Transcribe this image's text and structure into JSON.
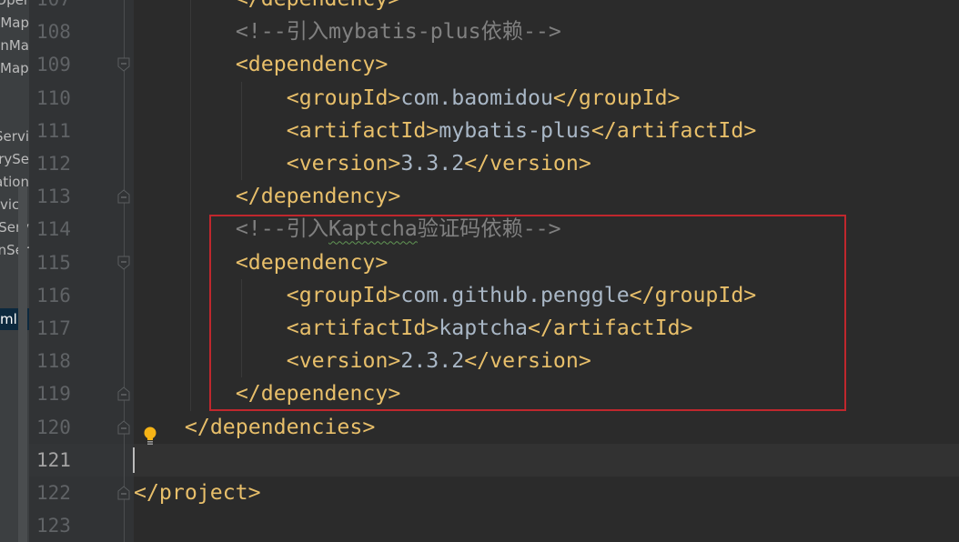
{
  "sidebar": {
    "items": [
      {
        "label": "Oper",
        "selected": false
      },
      {
        "label": "yMap",
        "selected": false
      },
      {
        "label": "onMa",
        "selected": false
      },
      {
        "label": "Map",
        "selected": false
      },
      {
        "label": "",
        "selected": false
      },
      {
        "label": "",
        "selected": false
      },
      {
        "label": "Servi",
        "selected": false
      },
      {
        "label": "gorySe",
        "selected": false
      },
      {
        "label": "ation",
        "selected": false
      },
      {
        "label": "vice",
        "selected": false
      },
      {
        "label": "yServ",
        "selected": false
      },
      {
        "label": "onSer",
        "selected": false
      },
      {
        "label": "",
        "selected": false
      },
      {
        "label": "",
        "selected": false
      },
      {
        "label": "ml",
        "selected": true
      }
    ]
  },
  "editor": {
    "current_line": 121,
    "lines": [
      {
        "number": "107",
        "indent": 8,
        "tokens": [
          {
            "t": "</dependency>",
            "c": "tag"
          }
        ]
      },
      {
        "number": "108",
        "indent": 8,
        "tokens": [
          {
            "t": "<!--引入mybatis-plus依赖-->",
            "c": "cmt"
          }
        ]
      },
      {
        "number": "109",
        "indent": 8,
        "fold": "open",
        "tokens": [
          {
            "t": "<dependency>",
            "c": "tag"
          }
        ]
      },
      {
        "number": "110",
        "indent": 12,
        "tokens": [
          {
            "t": "<groupId>",
            "c": "tag"
          },
          {
            "t": "com.baomidou",
            "c": "txt"
          },
          {
            "t": "</groupId>",
            "c": "tag"
          }
        ]
      },
      {
        "number": "111",
        "indent": 12,
        "tokens": [
          {
            "t": "<artifactId>",
            "c": "tag"
          },
          {
            "t": "mybatis-plus",
            "c": "txt"
          },
          {
            "t": "</artifactId>",
            "c": "tag"
          }
        ]
      },
      {
        "number": "112",
        "indent": 12,
        "tokens": [
          {
            "t": "<version>",
            "c": "tag"
          },
          {
            "t": "3.3.2",
            "c": "txt"
          },
          {
            "t": "</version>",
            "c": "tag"
          }
        ]
      },
      {
        "number": "113",
        "indent": 8,
        "fold": "close",
        "tokens": [
          {
            "t": "</dependency>",
            "c": "tag"
          }
        ]
      },
      {
        "number": "114",
        "indent": 8,
        "tokens": [
          {
            "t": "<!--引入",
            "c": "cmt"
          },
          {
            "t": "Kaptcha",
            "c": "cmt typo"
          },
          {
            "t": "验证码依赖-->",
            "c": "cmt"
          }
        ]
      },
      {
        "number": "115",
        "indent": 8,
        "fold": "open",
        "tokens": [
          {
            "t": "<dependency>",
            "c": "tag"
          }
        ]
      },
      {
        "number": "116",
        "indent": 12,
        "tokens": [
          {
            "t": "<groupId>",
            "c": "tag"
          },
          {
            "t": "com.github.penggle",
            "c": "txt"
          },
          {
            "t": "</groupId>",
            "c": "tag"
          }
        ]
      },
      {
        "number": "117",
        "indent": 12,
        "tokens": [
          {
            "t": "<artifactId>",
            "c": "tag"
          },
          {
            "t": "kaptcha",
            "c": "txt"
          },
          {
            "t": "</artifactId>",
            "c": "tag"
          }
        ]
      },
      {
        "number": "118",
        "indent": 12,
        "tokens": [
          {
            "t": "<version>",
            "c": "tag"
          },
          {
            "t": "2.3.2",
            "c": "txt"
          },
          {
            "t": "</version>",
            "c": "tag"
          }
        ]
      },
      {
        "number": "119",
        "indent": 8,
        "fold": "close",
        "tokens": [
          {
            "t": "</dependency>",
            "c": "tag"
          }
        ]
      },
      {
        "number": "120",
        "indent": 4,
        "fold": "close",
        "tokens": [
          {
            "t": "</dependencies>",
            "c": "tag"
          }
        ]
      },
      {
        "number": "121",
        "indent": 0,
        "tokens": []
      },
      {
        "number": "122",
        "indent": 0,
        "fold": "close",
        "tokens": [
          {
            "t": "</project>",
            "c": "tag"
          }
        ]
      },
      {
        "number": "123",
        "indent": 0,
        "tokens": []
      }
    ]
  },
  "colors": {
    "tag": "#e8bf6a",
    "comment": "#808080",
    "text": "#a9b7c6",
    "highlight_box": "#c0272d",
    "bulb": "#f5b316"
  },
  "icons": {
    "intention": "lightbulb-icon",
    "fold_open": "fold-open-icon",
    "fold_close": "fold-close-icon"
  }
}
